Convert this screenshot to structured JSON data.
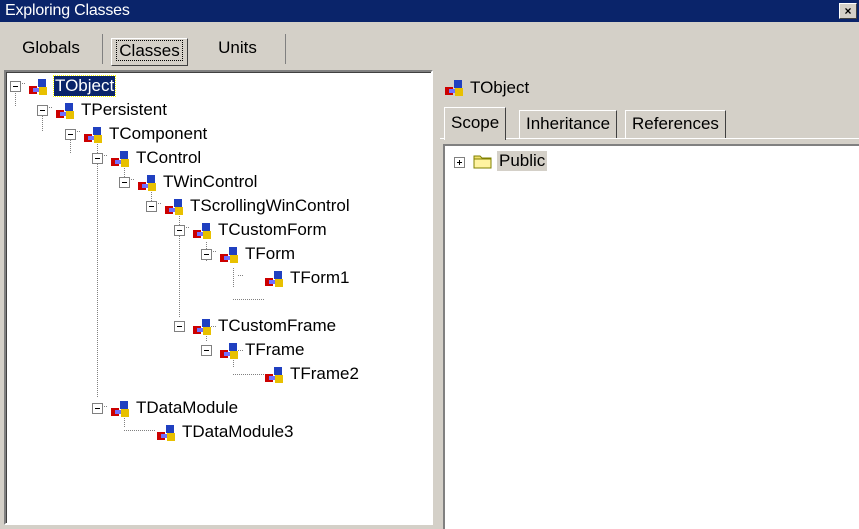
{
  "window": {
    "title": "Exploring Classes",
    "close_glyph": "×"
  },
  "tabs": [
    {
      "label": "Globals",
      "active": false
    },
    {
      "label": "Classes",
      "active": true
    },
    {
      "label": "Units",
      "active": false
    }
  ],
  "tree": {
    "nodes": [
      {
        "label": "TObject",
        "level": 0,
        "expanded": true,
        "selected": true
      },
      {
        "label": "TPersistent",
        "level": 1,
        "expanded": true
      },
      {
        "label": "TComponent",
        "level": 2,
        "expanded": true
      },
      {
        "label": "TControl",
        "level": 3,
        "expanded": true
      },
      {
        "label": "TWinControl",
        "level": 4,
        "expanded": true
      },
      {
        "label": "TScrollingWinControl",
        "level": 5,
        "expanded": true
      },
      {
        "label": "TCustomForm",
        "level": 6,
        "expanded": true
      },
      {
        "label": "TForm",
        "level": 7,
        "expanded": true
      },
      {
        "label": "TForm1",
        "level": 8,
        "leaf": true
      },
      {
        "label": "TCustomFrame",
        "level": 6,
        "expanded": true
      },
      {
        "label": "TFrame",
        "level": 7,
        "expanded": true
      },
      {
        "label": "TFrame2",
        "level": 8,
        "leaf": true
      },
      {
        "label": "TDataModule",
        "level": 3,
        "expanded": true
      },
      {
        "label": "TDataModule3",
        "level": 4,
        "leaf": true
      }
    ]
  },
  "detail": {
    "object_label": "TObject",
    "tabs": [
      {
        "label": "Scope",
        "active": true
      },
      {
        "label": "Inheritance",
        "active": false
      },
      {
        "label": "References",
        "active": false
      }
    ],
    "scope_items": [
      {
        "label": "Public",
        "icon": "folder-icon"
      }
    ]
  },
  "colors": {
    "titlebar": "#0a246a",
    "selection": "#0a246a",
    "face": "#d4d0c8"
  }
}
